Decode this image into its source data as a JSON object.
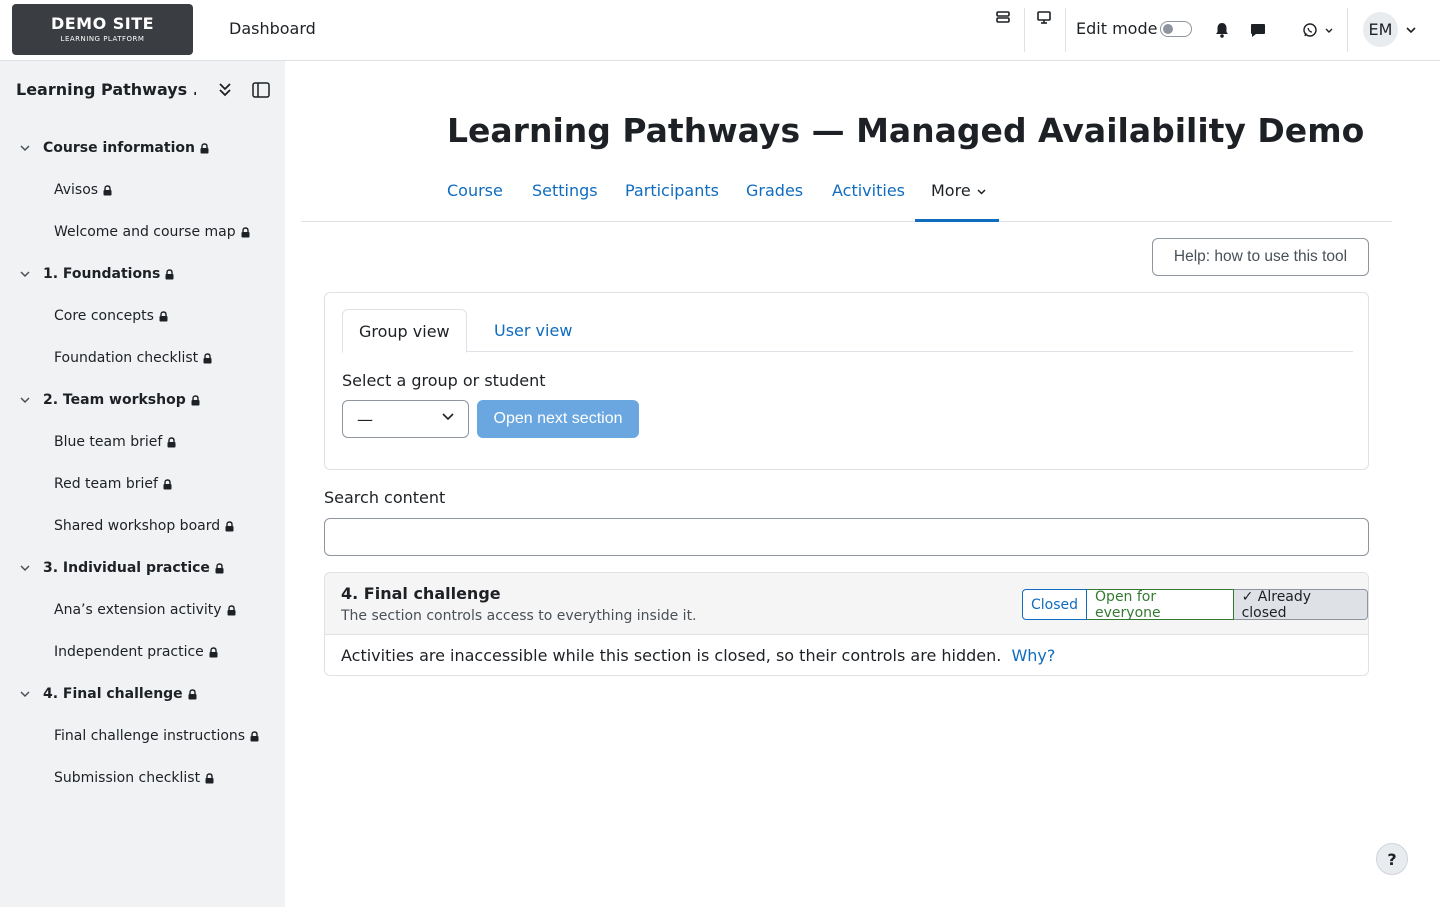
{
  "brand": {
    "name": "DEMO SITE",
    "tagline": "LEARNING PLATFORM"
  },
  "navbar": {
    "dashboard_label": "Dashboard",
    "edit_mode_label": "Edit mode",
    "user_initials": "EM"
  },
  "drawer": {
    "title": "Learning Pathways ...",
    "items": [
      {
        "label": "Course information",
        "type": "section"
      },
      {
        "label": "Avisos",
        "type": "activity"
      },
      {
        "label": "Welcome and course map",
        "type": "activity"
      },
      {
        "label": "1. Foundations",
        "type": "section"
      },
      {
        "label": "Core concepts",
        "type": "activity"
      },
      {
        "label": "Foundation checklist",
        "type": "activity"
      },
      {
        "label": "2. Team workshop",
        "type": "section"
      },
      {
        "label": "Blue team brief",
        "type": "activity"
      },
      {
        "label": "Red team brief",
        "type": "activity"
      },
      {
        "label": "Shared workshop board",
        "type": "activity"
      },
      {
        "label": "3. Individual practice",
        "type": "section"
      },
      {
        "label": "Ana’s extension activity",
        "type": "activity"
      },
      {
        "label": "Independent practice",
        "type": "activity"
      },
      {
        "label": "4. Final challenge",
        "type": "section"
      },
      {
        "label": "Final challenge instructions",
        "type": "activity"
      },
      {
        "label": "Submission checklist",
        "type": "activity"
      }
    ]
  },
  "main": {
    "page_title": "Learning Pathways — Managed Availability Demo",
    "tabs": [
      "Course",
      "Settings",
      "Participants",
      "Grades",
      "Activities",
      "More"
    ],
    "help_button": "Help: how to use this tool",
    "view_tabs": [
      "Group view",
      "User view"
    ],
    "select_label": "Select a group or student",
    "select_value": "—",
    "open_next_button": "Open next section",
    "search_label": "Search content",
    "search_value": "",
    "section": {
      "name": "4. Final challenge",
      "description": "The section controls access to everything inside it.",
      "states": [
        "Closed",
        "Open for everyone",
        "✓ Already closed"
      ],
      "body_text": "Activities are inaccessible while this section is closed, so their controls are hidden.",
      "why_link": "Why?"
    }
  },
  "help_fab": "?",
  "colors": {
    "link": "#0f6cbf",
    "success": "#357a32",
    "primary_disabled": "#6aa7e0",
    "drawer_bg": "#f1f2f4"
  }
}
